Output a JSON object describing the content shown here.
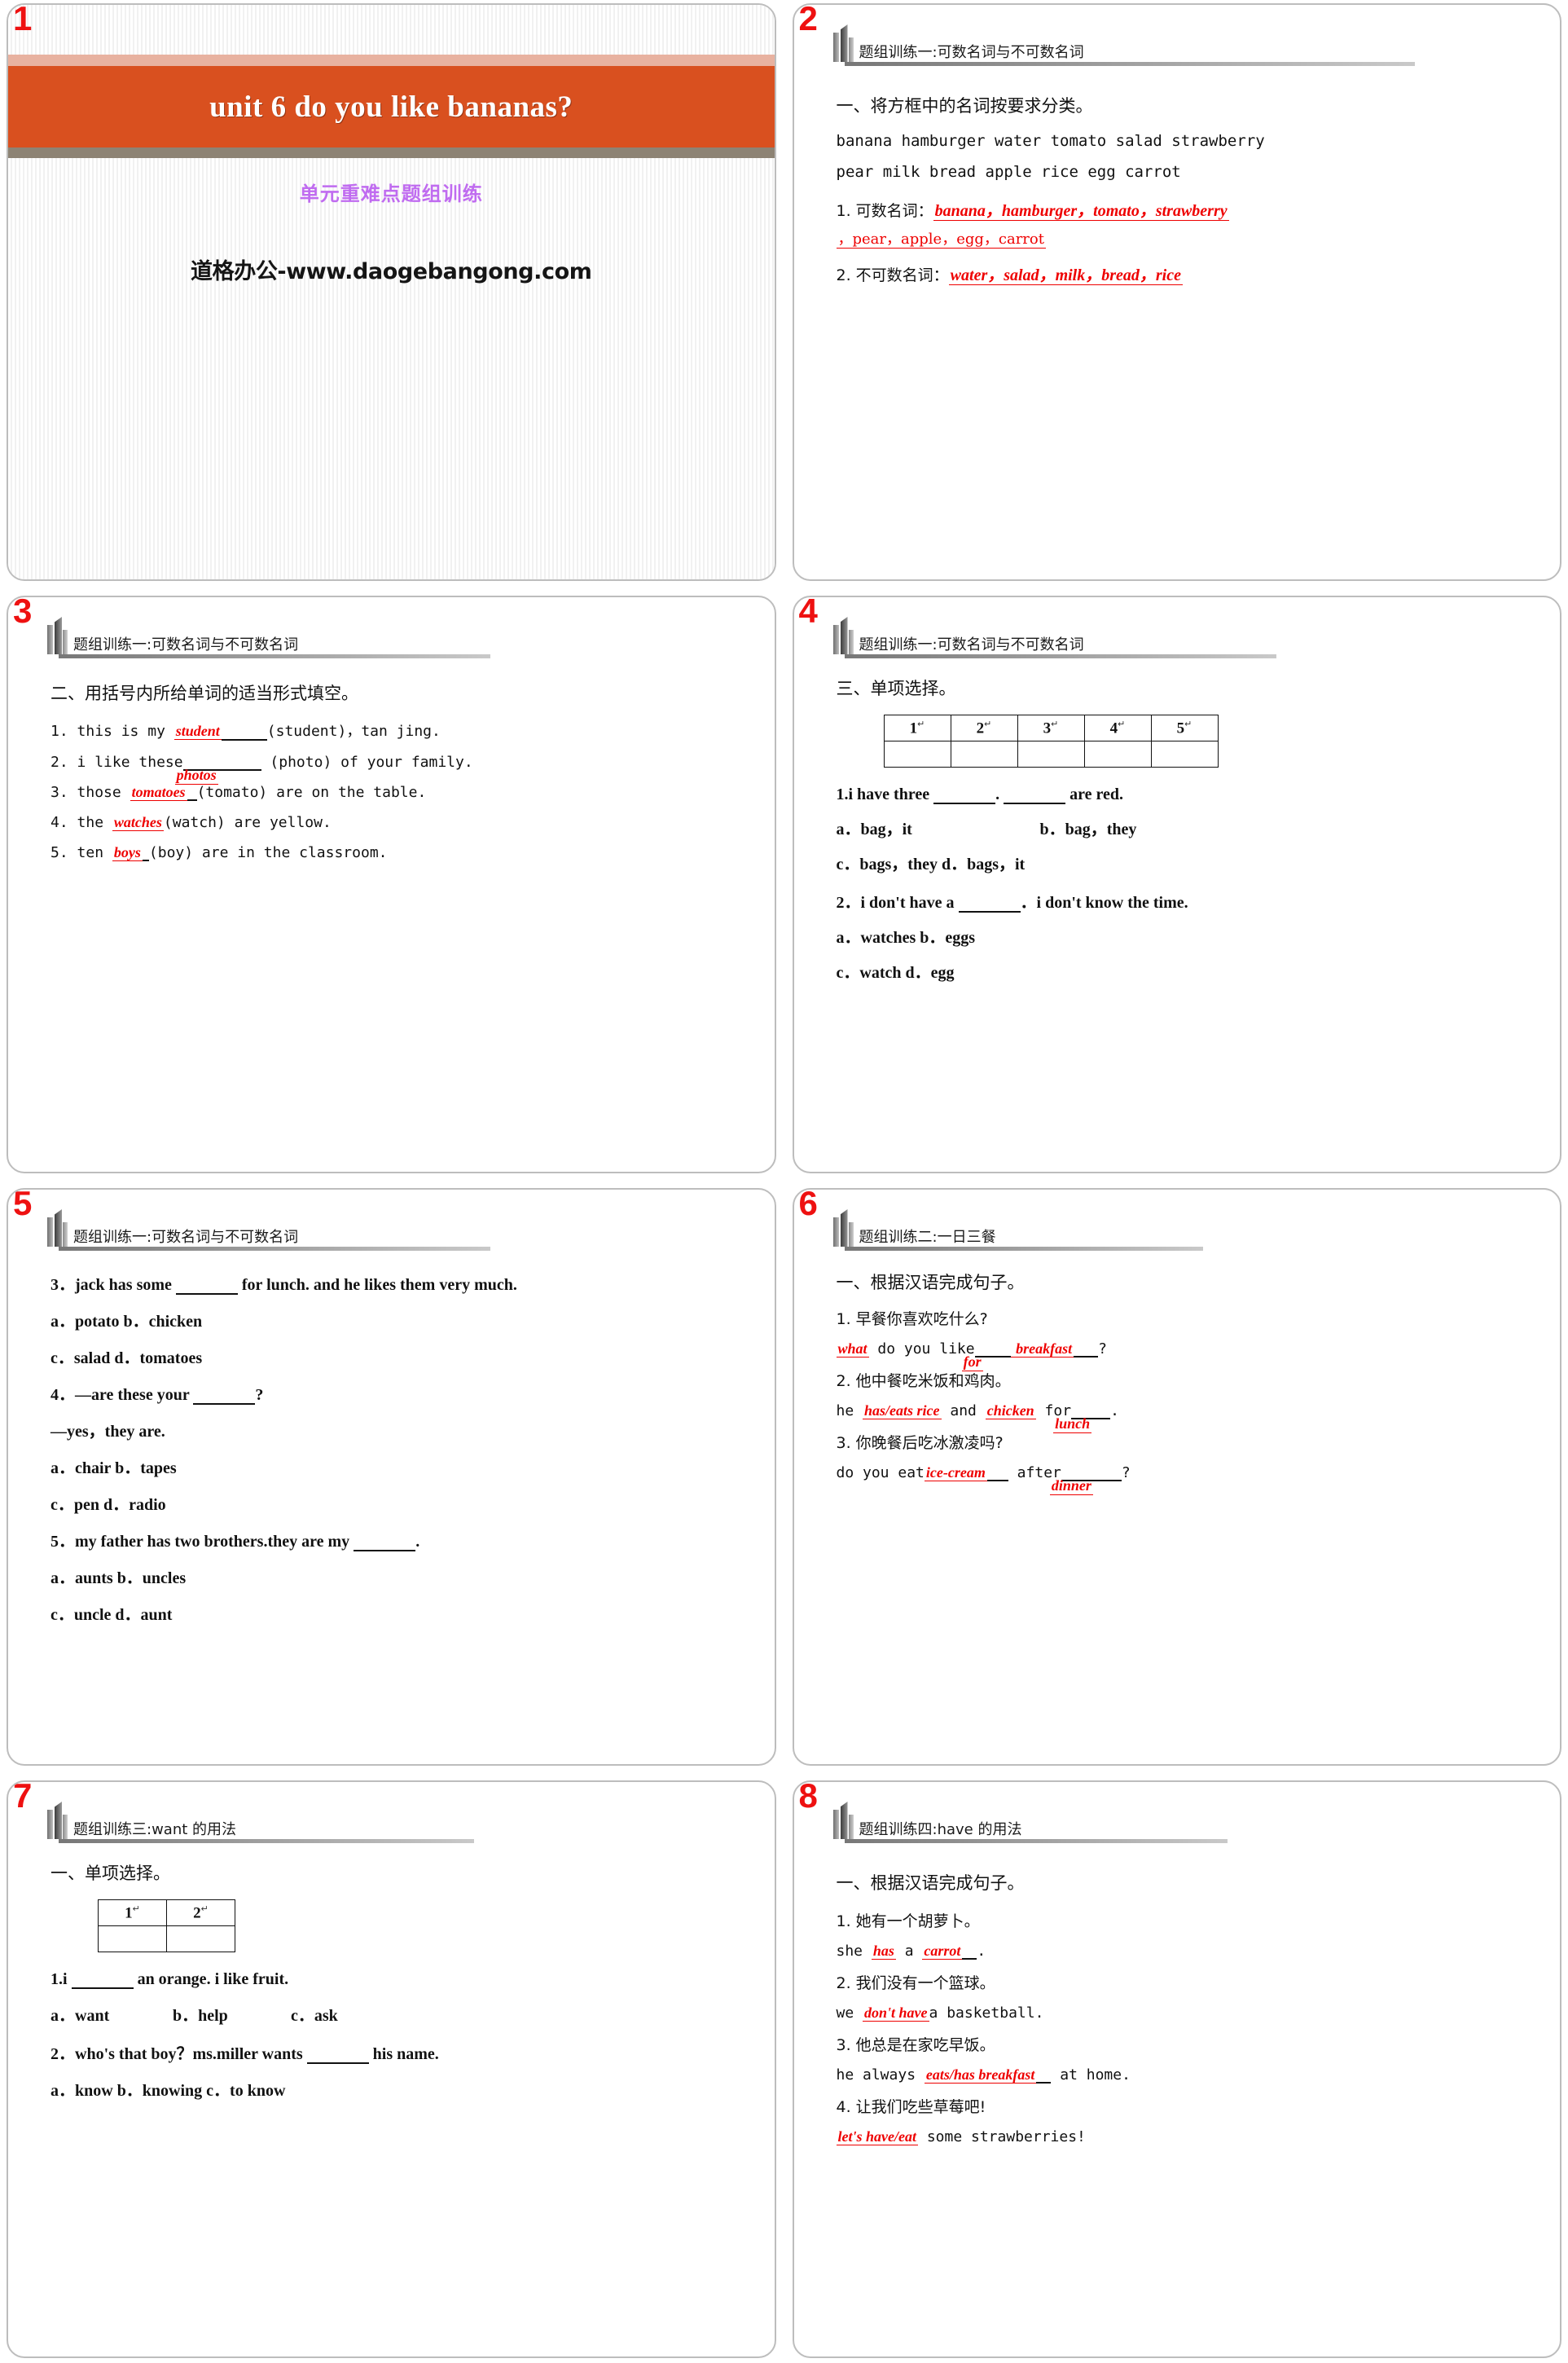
{
  "colors": {
    "accent_band": "#d9501f",
    "accent_band_top": "#e8b2a0",
    "accent_band_bottom": "#8d8374",
    "answer_red": "#ee0000",
    "slide_number_red": "#ee1111",
    "subtitle_purple": "#c06cf0"
  },
  "slides": [
    {
      "number": "1",
      "title": "unit 6  do you like bananas?",
      "subtitle": "单元重难点题组训练",
      "site": "道格办公-www.daogebangong.com"
    },
    {
      "number": "2",
      "header": "题组训练一:可数名词与不可数名词",
      "task": "一、将方框中的名词按要求分类。",
      "wordbox_line1": "banana  hamburger  water  tomato  salad  strawberry",
      "wordbox_line2": "pear  milk  bread  apple  rice  egg  carrot",
      "q1_label": "1. 可数名词：",
      "q1_answer_a": "banana，hamburger，tomato，strawberry",
      "q1_answer_b": "，pear，apple，egg，carrot",
      "q2_label": "2. 不可数名词：",
      "q2_answer": "water，salad，milk，bread，rice"
    },
    {
      "number": "3",
      "header": "题组训练一:可数名词与不可数名词",
      "task": "二、用括号内所给单词的适当形式填空。",
      "items": [
        {
          "num": "1.",
          "pre": "this is my ",
          "answer": "student",
          "post": "(student)，tan jing."
        },
        {
          "num": "2.",
          "pre": "i like these",
          "answer": "photos",
          "post": "(photo) of your family."
        },
        {
          "num": "3.",
          "pre": "those ",
          "answer": "tomatoes",
          "post": "(tomato) are on the table."
        },
        {
          "num": "4.",
          "pre": "the ",
          "answer": "watches",
          "post": "(watch) are yellow."
        },
        {
          "num": "5.",
          "pre": "ten ",
          "answer": "boys",
          "post": "(boy) are in the classroom."
        }
      ]
    },
    {
      "number": "4",
      "header": "题组训练一:可数名词与不可数名词",
      "task": "三、单项选择。",
      "grid_headers": [
        "1",
        "2",
        "3",
        "4",
        "5"
      ],
      "grid_answers": [
        "",
        "",
        "",
        "",
        ""
      ],
      "questions": [
        {
          "stem_pre": "1.i have three ",
          "stem_mid": ".  ",
          "stem_post": " are red.",
          "options_rows": [
            [
              "a．bag，it",
              "b．bag，they"
            ],
            [
              "c．bags，they d．bags，it"
            ]
          ]
        },
        {
          "stem_pre": "2．i don't have a ",
          "stem_post": "．i don't know the time.",
          "options_rows": [
            [
              "a．watches b．eggs"
            ],
            [
              "c．watch d．egg"
            ]
          ]
        }
      ]
    },
    {
      "number": "5",
      "header": "题组训练一:可数名词与不可数名词",
      "questions": [
        {
          "stem_pre": "3．jack has some ",
          "stem_post": " for lunch. and he likes them very much.",
          "options_rows": [
            [
              "a．potato b．chicken"
            ],
            [
              "c．salad d．tomatoes"
            ]
          ]
        },
        {
          "stem_pre": "4．—are these your ",
          "stem_post": "?",
          "extra_line": "—yes，they are.",
          "options_rows": [
            [
              "a．chair b．tapes"
            ],
            [
              "c．pen d．radio"
            ]
          ]
        },
        {
          "stem_pre": "5．my father has two brothers.they are my ",
          "stem_post": ".",
          "options_rows": [
            [
              "a．aunts b．uncles"
            ],
            [
              "c．uncle d．aunt"
            ]
          ]
        }
      ]
    },
    {
      "number": "6",
      "header": "题组训练二:一日三餐",
      "task": "一、根据汉语完成句子。",
      "items": [
        {
          "cn": "1. 早餐你喜欢吃什么?",
          "en_parts": [
            {
              "t": "ans",
              "v": "what"
            },
            {
              "t": "txt",
              "v": " do you like"
            },
            {
              "t": "ans-overlap",
              "v": "for"
            },
            {
              "t": "ans",
              "v": " breakfast"
            },
            {
              "t": "txt",
              "v": "?"
            }
          ]
        },
        {
          "cn": "2. 他中餐吃米饭和鸡肉。",
          "en_parts": [
            {
              "t": "txt",
              "v": "he "
            },
            {
              "t": "ans",
              "v": "has/eats rice"
            },
            {
              "t": "txt",
              "v": " and "
            },
            {
              "t": "ans",
              "v": "chicken"
            },
            {
              "t": "txt",
              "v": " for"
            },
            {
              "t": "ans-overlap",
              "v": "lunch"
            },
            {
              "t": "txt",
              "v": "."
            }
          ]
        },
        {
          "cn": "3. 你晚餐后吃冰激凌吗?",
          "en_parts": [
            {
              "t": "txt",
              "v": "do you eat"
            },
            {
              "t": "ans",
              "v": "ice-cream"
            },
            {
              "t": "txt",
              "v": " after"
            },
            {
              "t": "ans-overlap",
              "v": "dinner"
            },
            {
              "t": "txt",
              "v": "?"
            }
          ]
        }
      ]
    },
    {
      "number": "7",
      "header": "题组训练三:want 的用法",
      "task": "一、单项选择。",
      "grid_headers": [
        "1",
        "2"
      ],
      "grid_answers": [
        "",
        ""
      ],
      "questions": [
        {
          "stem_pre": "1.i ",
          "stem_post": " an orange. i like fruit.",
          "options_rows": [
            [
              "a．want",
              "b．help",
              "c．ask"
            ]
          ]
        },
        {
          "stem_pre": "2．who's that boy？ms.miller wants ",
          "stem_post": " his name.",
          "options_rows": [
            [
              "a．know b．knowing c．to know"
            ]
          ]
        }
      ]
    },
    {
      "number": "8",
      "header": "题组训练四:have 的用法",
      "task": "一、根据汉语完成句子。",
      "items": [
        {
          "cn": "1. 她有一个胡萝卜。",
          "en_parts": [
            {
              "t": "txt",
              "v": "she "
            },
            {
              "t": "ans",
              "v": "has"
            },
            {
              "t": "txt",
              "v": " a "
            },
            {
              "t": "ans",
              "v": "carrot"
            },
            {
              "t": "txt",
              "v": "."
            }
          ]
        },
        {
          "cn": "2. 我们没有一个篮球。",
          "en_parts": [
            {
              "t": "txt",
              "v": "we "
            },
            {
              "t": "ans",
              "v": "don't have"
            },
            {
              "t": "txt",
              "v": "a basketball."
            }
          ]
        },
        {
          "cn": "3. 他总是在家吃早饭。",
          "en_parts": [
            {
              "t": "txt",
              "v": "he always "
            },
            {
              "t": "ans",
              "v": "eats/has breakfast"
            },
            {
              "t": "txt",
              "v": " at home."
            }
          ]
        },
        {
          "cn": "4. 让我们吃些草莓吧!",
          "en_parts": [
            {
              "t": "ans",
              "v": "let's have/eat"
            },
            {
              "t": "txt",
              "v": "  some strawberries!"
            }
          ]
        }
      ]
    }
  ]
}
